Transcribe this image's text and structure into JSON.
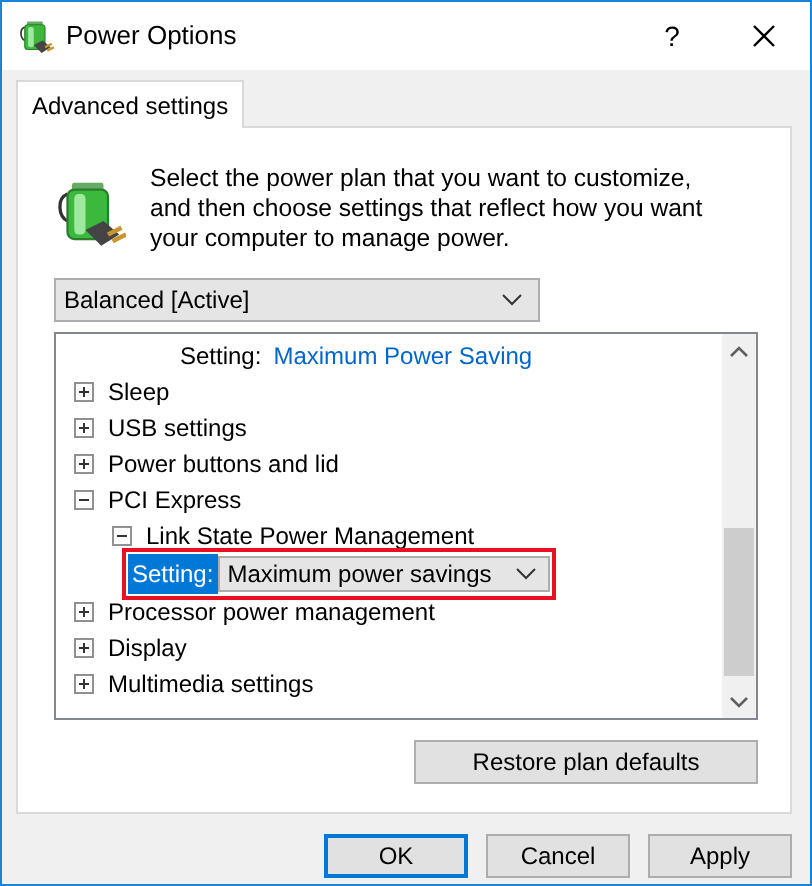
{
  "window": {
    "title": "Power Options",
    "help": "?"
  },
  "tabs": [
    {
      "label": "Advanced settings",
      "selected": true
    }
  ],
  "intro": "Select the power plan that you want to customize, and then choose settings that reflect how you want your computer to manage power.",
  "plan_select": {
    "value": "Balanced [Active]"
  },
  "tree": [
    {
      "kind": "setting",
      "label": "Setting:",
      "value": "Maximum Power Saving"
    },
    {
      "kind": "group",
      "label": "Sleep",
      "expanded": false
    },
    {
      "kind": "group",
      "label": "USB settings",
      "expanded": false
    },
    {
      "kind": "group",
      "label": "Power buttons and lid",
      "expanded": false
    },
    {
      "kind": "group",
      "label": "PCI Express",
      "expanded": true,
      "children": [
        {
          "kind": "group",
          "label": "Link State Power Management",
          "expanded": true,
          "children": [
            {
              "kind": "dropdown",
              "label": "Setting:",
              "value": "Maximum power savings",
              "selected": true,
              "highlighted": true
            }
          ]
        }
      ]
    },
    {
      "kind": "group",
      "label": "Processor power management",
      "expanded": false
    },
    {
      "kind": "group",
      "label": "Display",
      "expanded": false
    },
    {
      "kind": "group",
      "label": "Multimedia settings",
      "expanded": false
    }
  ],
  "restore_button": "Restore plan defaults",
  "buttons": [
    {
      "label": "OK",
      "default": true
    },
    {
      "label": "Cancel",
      "default": false
    },
    {
      "label": "Apply",
      "default": false
    }
  ]
}
